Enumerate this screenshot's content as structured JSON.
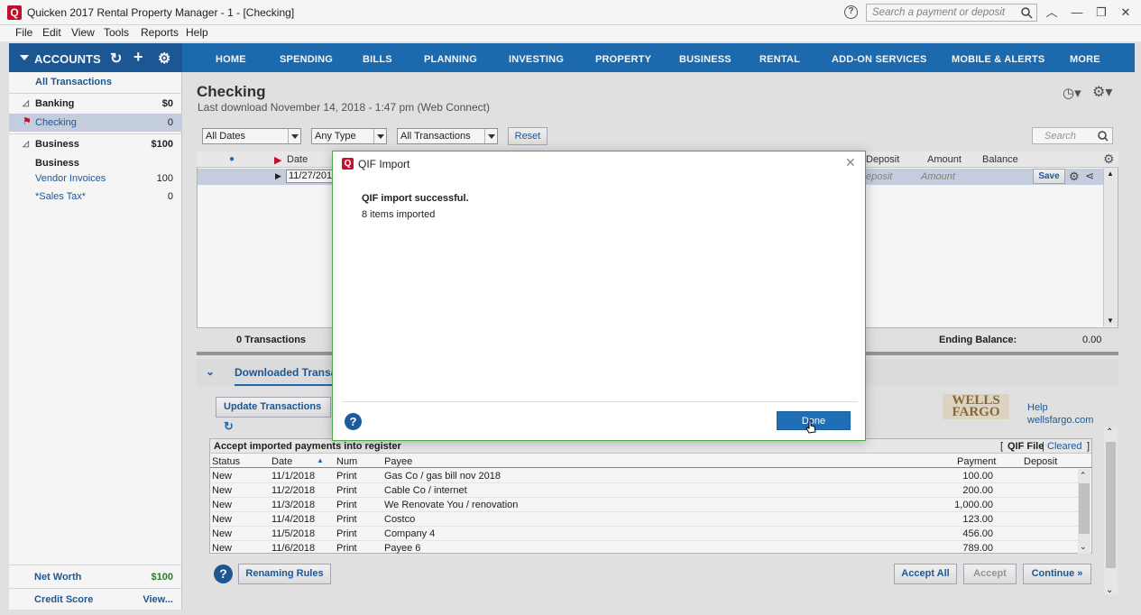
{
  "window": {
    "title": "Quicken 2017 Rental Property Manager - 1 - [Checking]",
    "search_placeholder": "Search a payment or deposit",
    "logo_letter": "Q"
  },
  "menu": [
    "File",
    "Edit",
    "View",
    "Tools",
    "Reports",
    "Help"
  ],
  "accounts_header": "ACCOUNTS",
  "nav_tabs": [
    "HOME",
    "SPENDING",
    "BILLS",
    "PLANNING",
    "INVESTING",
    "PROPERTY",
    "BUSINESS",
    "RENTAL",
    "ADD-ON SERVICES",
    "MOBILE & ALERTS",
    "MORE"
  ],
  "sidebar": {
    "all_transactions": "All Transactions",
    "banking": {
      "label": "Banking",
      "amount": "$0"
    },
    "checking": {
      "label": "Checking",
      "amount": "0"
    },
    "business": {
      "label": "Business",
      "amount": "$100"
    },
    "business_sub": "Business",
    "vendor_invoices": {
      "label": "Vendor Invoices",
      "amount": "100"
    },
    "sales_tax": {
      "label": "*Sales Tax*",
      "amount": "0"
    },
    "net_worth": {
      "label": "Net Worth",
      "amount": "$100"
    },
    "credit_score": {
      "label": "Credit Score",
      "link": "View..."
    }
  },
  "register": {
    "title": "Checking",
    "last_download": "Last download November 14, 2018 - 1:47 pm (Web Connect)",
    "filters": {
      "dates": "All Dates",
      "type": "Any Type",
      "transactions": "All Transactions",
      "reset": "Reset"
    },
    "search_placeholder": "Search",
    "columns": {
      "date": "Date",
      "deposit": "Deposit",
      "amount": "Amount",
      "balance": "Balance"
    },
    "entry": {
      "date": "11/27/201",
      "deposit_ph": "eposit",
      "amount_ph": "Amount",
      "save": "Save"
    },
    "transactions_count": "0 Transactions",
    "ending_balance_label": "Ending Balance:",
    "ending_balance": "0.00"
  },
  "downloaded": {
    "tab_label": "Downloaded Transa",
    "update_button": "Update Transactions",
    "bank_logo_line1": "WELLS",
    "bank_logo_line2": "FARGO",
    "help_link": "Help",
    "site_link": "wellsfargo.com",
    "panel_title": "Accept imported payments into register",
    "qif_file": "QIF File",
    "cleared": "Cleared",
    "headers": {
      "status": "Status",
      "date": "Date",
      "num": "Num",
      "payee": "Payee",
      "payment": "Payment",
      "deposit": "Deposit"
    },
    "rows": [
      {
        "status": "New",
        "date": "11/1/2018",
        "num": "Print",
        "payee": "Gas Co / gas bill nov 2018",
        "payment": "100.00"
      },
      {
        "status": "New",
        "date": "11/2/2018",
        "num": "Print",
        "payee": "Cable Co / internet",
        "payment": "200.00"
      },
      {
        "status": "New",
        "date": "11/3/2018",
        "num": "Print",
        "payee": "We Renovate You / renovation",
        "payment": "1,000.00"
      },
      {
        "status": "New",
        "date": "11/4/2018",
        "num": "Print",
        "payee": "Costco",
        "payment": "123.00"
      },
      {
        "status": "New",
        "date": "11/5/2018",
        "num": "Print",
        "payee": "Company 4",
        "payment": "456.00"
      },
      {
        "status": "New",
        "date": "11/6/2018",
        "num": "Print",
        "payee": "Payee 6",
        "payment": "789.00"
      }
    ],
    "renaming_rules": "Renaming Rules",
    "accept_all": "Accept All",
    "accept": "Accept",
    "continue": "Continue »"
  },
  "modal": {
    "title": "QIF Import",
    "message_bold": "QIF import successful.",
    "message": "8 items imported",
    "done": "Done"
  },
  "colors": {
    "accent": "#1f6eb6",
    "accounts_bar": "#1f5b9a",
    "logo_red": "#c8102e",
    "selected_row": "#cdd6e6"
  }
}
